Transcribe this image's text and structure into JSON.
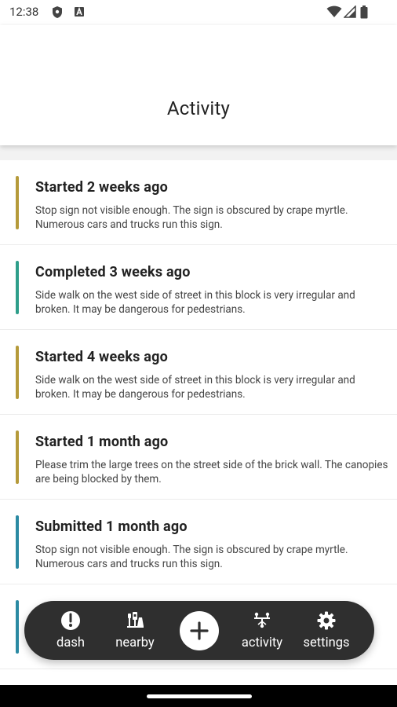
{
  "status_bar": {
    "time": "12:38"
  },
  "header": {
    "title": "Activity"
  },
  "activities": [
    {
      "title": "Started 2 weeks ago",
      "description": "Stop sign not visible enough. The sign is obscured by crape myrtle. Numerous cars and trucks run this sign.",
      "color": "#b59a3a"
    },
    {
      "title": "Completed 3 weeks ago",
      "description": "Side walk on the west side of street in this block is very irregular and broken. It may be dangerous for pedestrians.",
      "color": "#2e9e8a"
    },
    {
      "title": "Started 4 weeks ago",
      "description": "Side walk on the west side of street in this block is very irregular and broken. It may be dangerous for pedestrians.",
      "color": "#b59a3a"
    },
    {
      "title": "Started 1 month ago",
      "description": "Please trim the large trees on the street side of the brick wall. The canopies are being blocked by them.",
      "color": "#b59a3a"
    },
    {
      "title": "Submitted 1 month ago",
      "description": "Stop sign not visible enough. The sign is obscured by crape myrtle. Numerous cars and trucks run this sign.",
      "color": "#2b8aa3"
    },
    {
      "title": "",
      "description": "",
      "color": "#2b8aa3"
    }
  ],
  "nav": {
    "dash": "dash",
    "nearby": "nearby",
    "activity": "activity",
    "settings": "settings"
  },
  "icons": {
    "status": [
      "shield-icon",
      "font-icon",
      "wifi-icon",
      "signal-icon",
      "battery-icon"
    ],
    "nav": [
      "dash-icon",
      "nearby-icon",
      "add-icon",
      "activity-icon",
      "settings-icon"
    ]
  }
}
